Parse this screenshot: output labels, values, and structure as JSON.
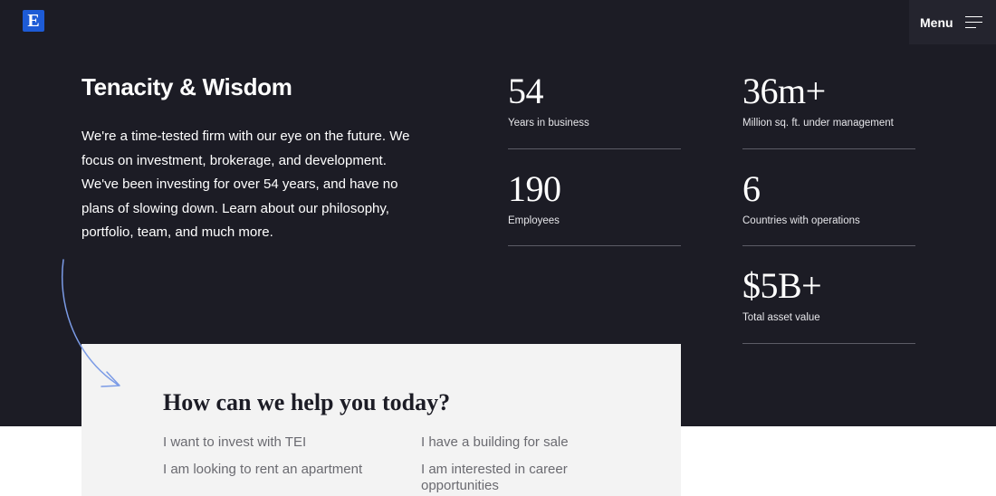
{
  "header": {
    "logo_text": "E",
    "menu_label": "Menu"
  },
  "intro": {
    "heading": "Tenacity & Wisdom",
    "body": "We're a time-tested firm with our eye on the future. We focus on investment, brokerage, and development. We've been investing for over 54 years, and have no plans of slowing down. Learn about our philosophy, portfolio, team, and much more."
  },
  "stats": [
    {
      "value": "54",
      "label": "Years in business"
    },
    {
      "value": "36m+",
      "label": "Million sq. ft. under management"
    },
    {
      "value": "190",
      "label": "Employees"
    },
    {
      "value": "6",
      "label": "Countries with operations"
    },
    {
      "value": "$5B+",
      "label": "Total asset value"
    }
  ],
  "help": {
    "title": "How can we help you today?",
    "links": [
      "I want to invest with TEI",
      "I have a building for sale",
      "I am looking to rent an apartment",
      "I am interested in career opportunities"
    ]
  },
  "colors": {
    "background_dark": "#1c1c25",
    "logo_blue": "#1d5bd6",
    "card_bg": "#f3f3f3",
    "arrow_blue": "#7b9be6"
  }
}
